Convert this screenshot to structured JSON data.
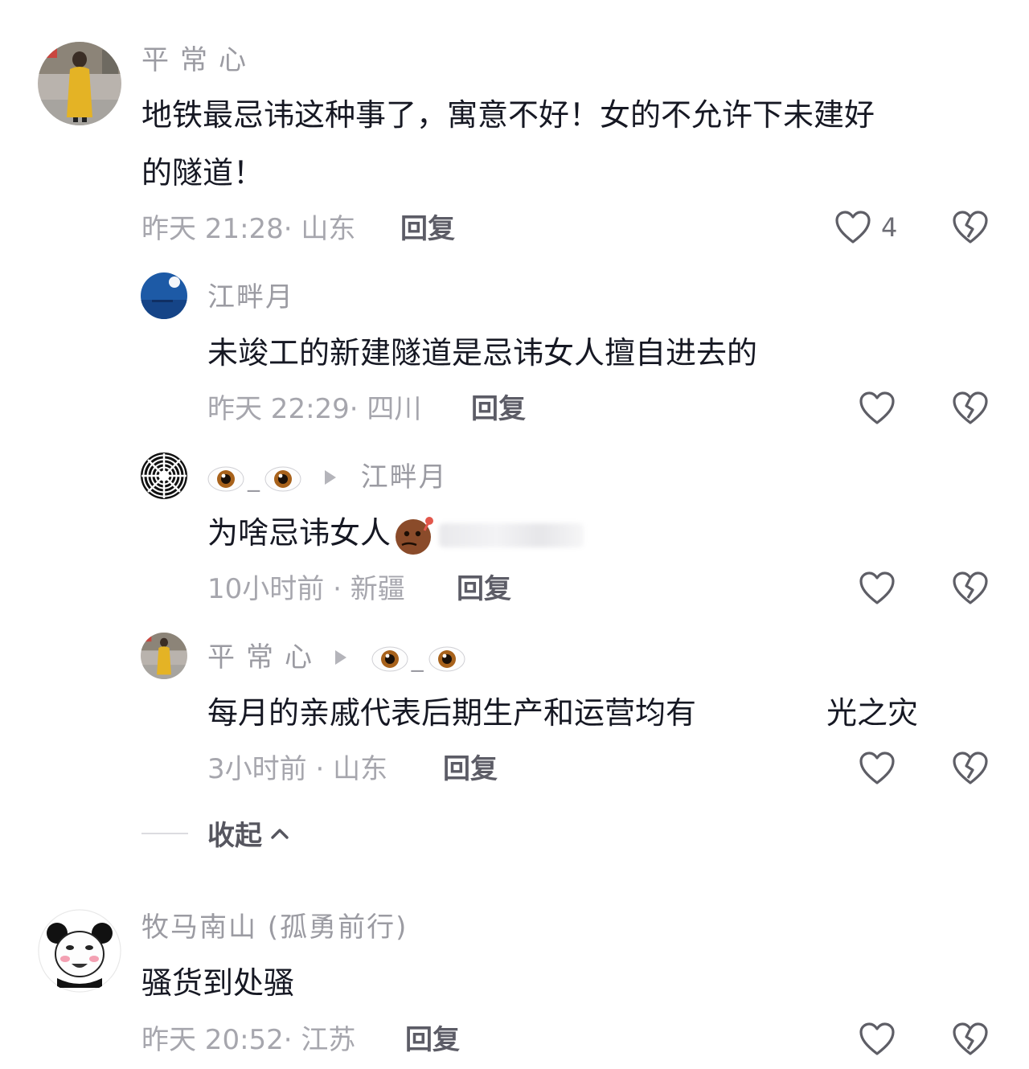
{
  "comments": [
    {
      "username": "平常心",
      "text_line1": "地铁最忌讳这种事了，寓意不好！女的不允许下未建好",
      "text_line2": "的隧道！",
      "time": "昨天 21:28",
      "location": "山东",
      "reply_label": "回复",
      "like_count": "4",
      "avatar_icon": "woman-yellow-coat-photo"
    },
    {
      "username": "江畔月",
      "text": "未竣工的新建隧道是忌讳女人擅自进去的",
      "time": "昨天 22:29",
      "location": "四川",
      "reply_label": "回复",
      "avatar_icon": "moon-over-sea-photo"
    },
    {
      "reply_to": "江畔月",
      "eye_separator": "_",
      "text": "为啥忌讳女人",
      "time": "10小时前",
      "location": "新疆",
      "reply_label": "回复",
      "avatar_icon": "hypnotic-spiral-avatar",
      "username_icon": "eyes-emoji",
      "inline_emoji": "thinking-emoji"
    },
    {
      "username": "平常心",
      "reply_to_icon": "eyes-emoji",
      "eye_separator": "_",
      "text_a": "每月的亲戚代表后期生产和运营均有",
      "text_b": "光之灾",
      "time": "3小时前",
      "location": "山东",
      "reply_label": "回复",
      "avatar_icon": "woman-yellow-coat-photo"
    },
    {
      "username": "牧马南山 (孤勇前行)",
      "text": "骚货到处骚",
      "time": "昨天 20:52",
      "location": "江苏",
      "reply_label": "回复",
      "avatar_icon": "panda-meme-avatar"
    }
  ],
  "collapse_label": "收起",
  "colors": {
    "text": "#161823",
    "meta": "#a6a6ad",
    "username": "#9b9ba2"
  }
}
